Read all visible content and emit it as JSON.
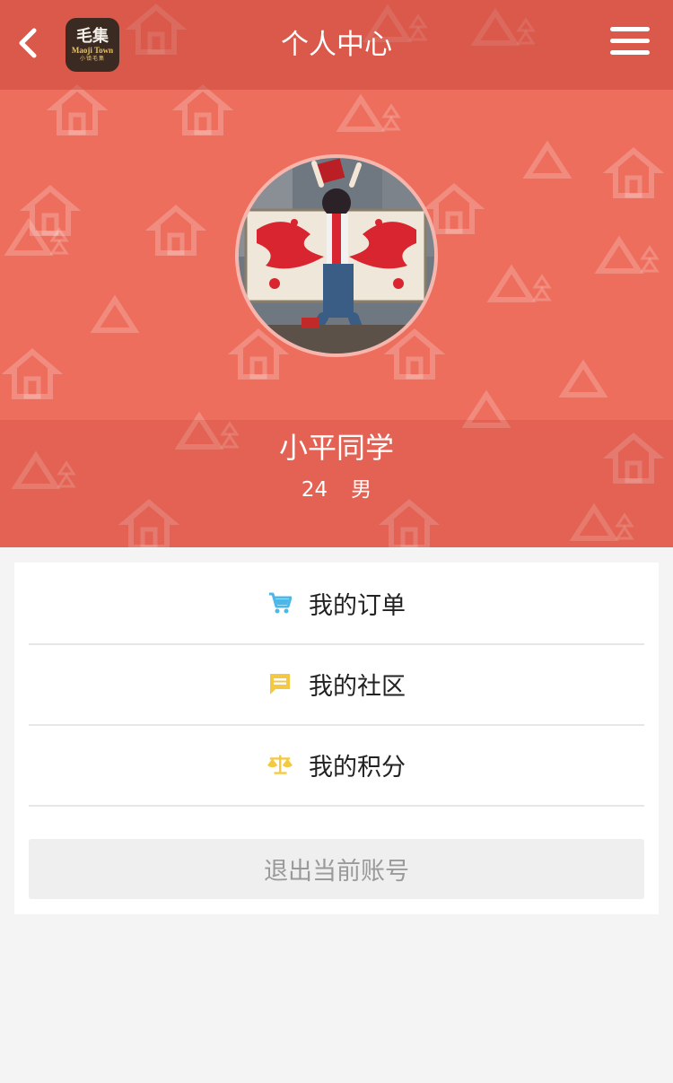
{
  "header": {
    "title": "个人中心",
    "logo": {
      "text_cn": "毛集",
      "text_en": "Maoji Town",
      "text_sub": "小镇毛集"
    }
  },
  "profile": {
    "name": "小平同学",
    "age": "24",
    "gender": "男"
  },
  "menu": [
    {
      "label": "我的订单",
      "icon": "cart-icon",
      "color": "#4db8e8"
    },
    {
      "label": "我的社区",
      "icon": "message-icon",
      "color": "#f5c842"
    },
    {
      "label": "我的积分",
      "icon": "scale-icon",
      "color": "#f5c842"
    }
  ],
  "logout_label": "退出当前账号",
  "colors": {
    "brand": "#ee6e5d",
    "page_bg": "#f4f4f4"
  }
}
